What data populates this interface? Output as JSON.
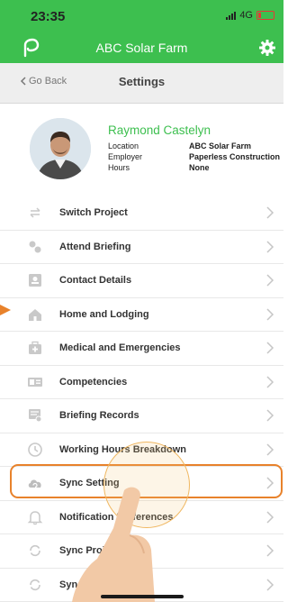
{
  "status_bar": {
    "time": "23:35",
    "network": "4G"
  },
  "app_bar": {
    "title": "ABC Solar Farm",
    "logo_icon": "leaf-p-logo",
    "settings_icon": "gear-icon"
  },
  "nav_bar": {
    "back_label": "Go Back",
    "title": "Settings"
  },
  "profile": {
    "name": "Raymond Castelyn",
    "fields": [
      {
        "label": "Location",
        "value": "ABC Solar Farm"
      },
      {
        "label": "Employer",
        "value": "Paperless Construction"
      },
      {
        "label": "Hours",
        "value": "None"
      }
    ]
  },
  "menu": {
    "items": [
      {
        "label": "Switch Project",
        "icon": "switch-icon"
      },
      {
        "label": "Attend Briefing",
        "icon": "briefing-icon"
      },
      {
        "label": "Contact Details",
        "icon": "contact-icon"
      },
      {
        "label": "Home and Lodging",
        "icon": "home-icon"
      },
      {
        "label": "Medical and Emergencies",
        "icon": "medical-icon"
      },
      {
        "label": "Competencies",
        "icon": "id-card-icon"
      },
      {
        "label": "Briefing Records",
        "icon": "records-icon"
      },
      {
        "label": "Working Hours Breakdown",
        "icon": "clock-icon"
      },
      {
        "label": "Sync Setting",
        "icon": "cloud-sync-icon"
      },
      {
        "label": "Notification Preferences",
        "icon": "bell-icon"
      },
      {
        "label": "Sync Project Data",
        "icon": "sync-icon"
      },
      {
        "label": "Sync Projects Data",
        "icon": "sync-icon"
      }
    ]
  },
  "colors": {
    "brand_green": "#3dbf4f",
    "highlight_orange": "#e8822b"
  }
}
